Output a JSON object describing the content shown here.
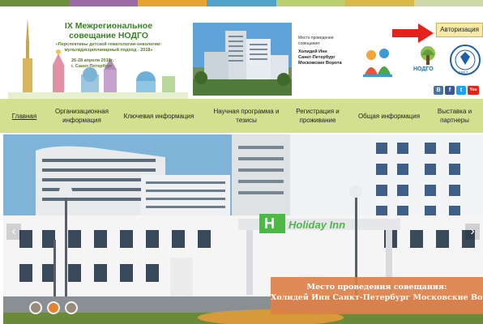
{
  "conference": {
    "title_line1": "IX Межрегиональное",
    "title_line2": "совещание НОДГО",
    "subtitle": "«Перспективы детской гематологии-онкологии: мультидисциплинарный подход - 2018»",
    "date_line1": "26-28 апреля 2018г.",
    "date_line2": "г. Санкт-Петербург"
  },
  "venue": {
    "label_line1": "Место проведения",
    "label_line2": "совещания:",
    "name_line1": "Холидей Инн",
    "name_line2": "Санкт-Петербург",
    "name_line3": "Московские Ворота"
  },
  "partners": {
    "nodgo_label": "НОДГО",
    "seal_year": "1957"
  },
  "social": [
    "В",
    "f",
    "t",
    "You"
  ],
  "auth": {
    "label": "Авторизация"
  },
  "nav": {
    "items": [
      {
        "label": "Главная"
      },
      {
        "label_line1": "Организационная",
        "label_line2": "информация"
      },
      {
        "label": "Ключевая информация"
      },
      {
        "label_line1": "Научная программа и",
        "label_line2": "тезисы"
      },
      {
        "label_line1": "Регистрация и",
        "label_line2": "проживание"
      },
      {
        "label": "Общая информация"
      },
      {
        "label_line1": "Выставка и",
        "label_line2": "партнеры"
      }
    ]
  },
  "hero": {
    "caption_line1": "Место проведения совещания:",
    "caption_line2": "Холидей Инн Санкт-Петербург Московские Ворота",
    "hotel_sign": "Holiday Inn",
    "prev_label": "‹",
    "next_label": "›",
    "slide_count": 3,
    "active_slide": 2
  },
  "colors": {
    "nav_bg": "#d3e08f",
    "caption_bg": "#de8046",
    "auth_bg": "#f7e9a8",
    "conf_green": "#3b7f2a"
  }
}
